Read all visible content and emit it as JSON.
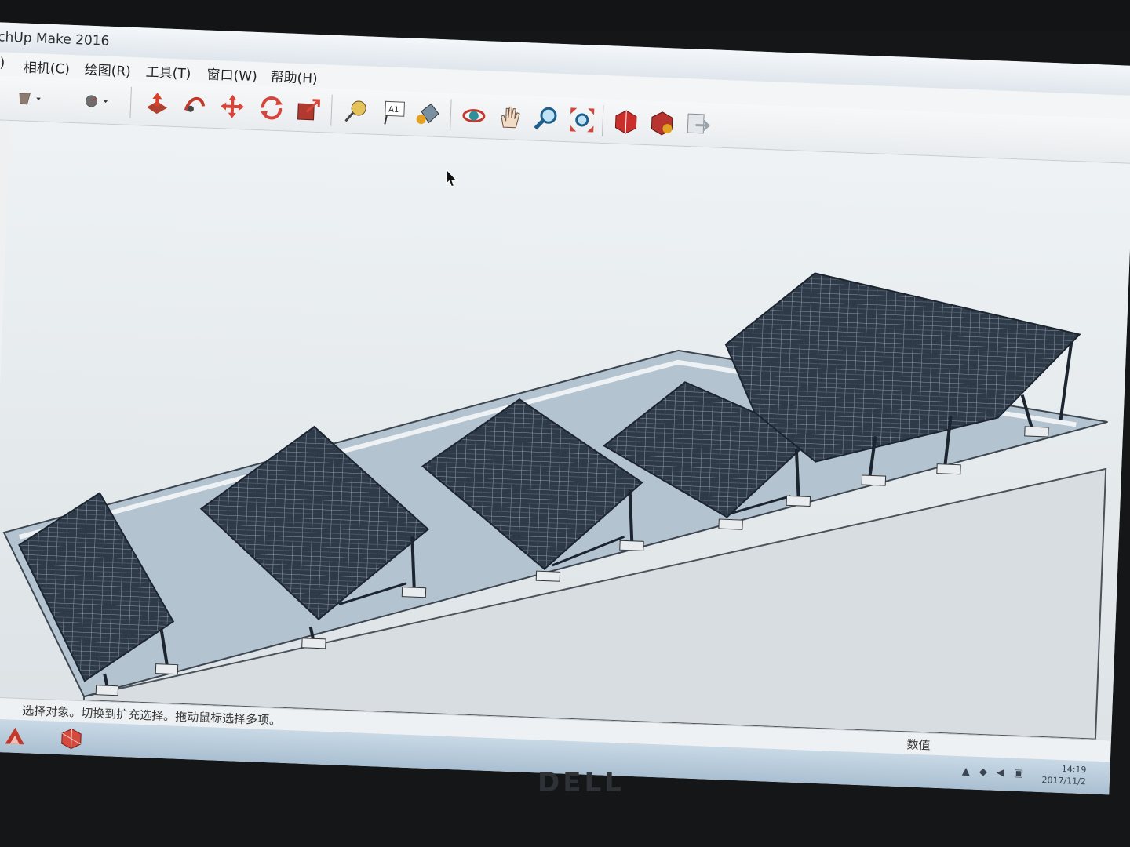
{
  "window": {
    "title": "chUp Make 2016"
  },
  "menu": [
    {
      "label": "V)"
    },
    {
      "label": "相机(C)"
    },
    {
      "label": "绘图(R)"
    },
    {
      "label": "工具(T)"
    },
    {
      "label": "窗口(W)"
    },
    {
      "label": "帮助(H)"
    }
  ],
  "toolbar": {
    "tools": [
      {
        "icon": "paint-dropdown-icon"
      },
      {
        "icon": "line-style-dropdown-icon"
      },
      {
        "icon": "push-pull-icon"
      },
      {
        "icon": "follow-me-icon"
      },
      {
        "icon": "move-icon"
      },
      {
        "icon": "rotate-icon"
      },
      {
        "icon": "scale-icon"
      },
      {
        "icon": "tape-measure-icon"
      },
      {
        "icon": "text-icon",
        "text": "A1"
      },
      {
        "icon": "paint-bucket-icon"
      },
      {
        "icon": "orbit-icon"
      },
      {
        "icon": "pan-icon"
      },
      {
        "icon": "zoom-icon"
      },
      {
        "icon": "zoom-extents-icon"
      },
      {
        "icon": "3d-warehouse-icon"
      },
      {
        "icon": "extension-warehouse-icon"
      },
      {
        "icon": "send-to-layout-icon"
      }
    ]
  },
  "status": {
    "message": "选择对象。切换到扩充选择。拖动鼠标选择多项。",
    "value_label": "数值"
  },
  "taskbar": {
    "apps": [
      {
        "icon": "autocad-icon"
      },
      {
        "icon": "sketchup-icon"
      }
    ],
    "clock_time": "14:19",
    "clock_date": "2017/11/2"
  },
  "bezel": {
    "brand": "DELL"
  },
  "colors": {
    "panel": "#2f3a48",
    "panel_frame": "#1c2430",
    "roof": "#b3c3cf",
    "wall": "#d7dde1"
  }
}
